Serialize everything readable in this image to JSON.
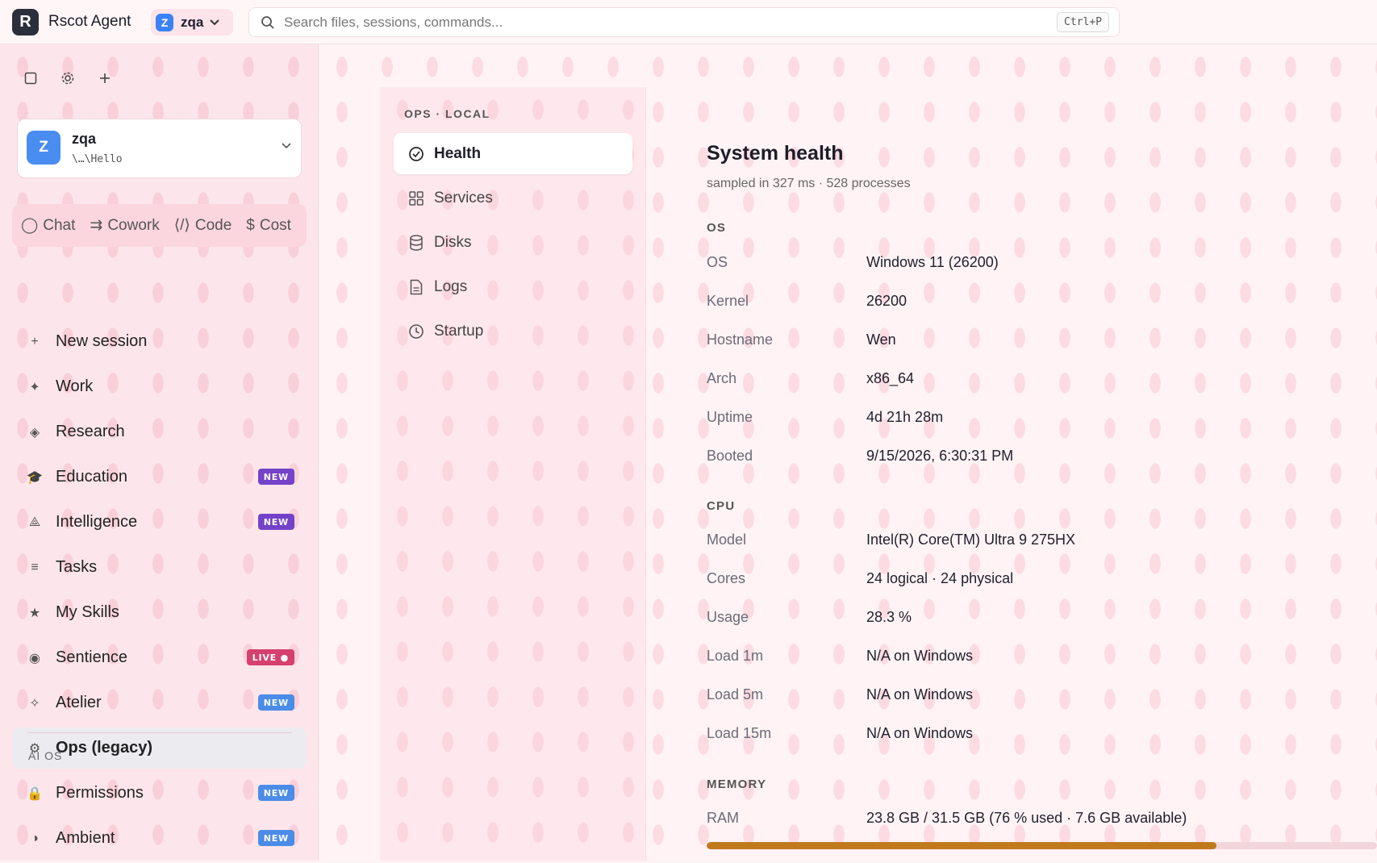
{
  "app": {
    "name": "Rscot Agent",
    "logo_letter": "R"
  },
  "workspace_pill": {
    "avatar": "Z",
    "name": "zqa"
  },
  "search": {
    "placeholder": "Search files, sessions, commands...",
    "shortcut": "Ctrl+P"
  },
  "workspace_card": {
    "avatar": "Z",
    "name": "zqa",
    "path": "\\…\\Hello"
  },
  "mode_tabs": [
    {
      "icon": "◯",
      "label": "Chat"
    },
    {
      "icon": "⇉",
      "label": "Cowork"
    },
    {
      "icon": "⟨/⟩",
      "label": "Code"
    },
    {
      "icon": "$",
      "label": "Cost"
    }
  ],
  "nav": [
    {
      "icon": "+",
      "label": "New session",
      "badge": ""
    },
    {
      "icon": "✦",
      "label": "Work",
      "badge": ""
    },
    {
      "icon": "◈",
      "label": "Research",
      "badge": ""
    },
    {
      "icon": "🎓",
      "label": "Education",
      "badge": "NEW"
    },
    {
      "icon": "⟁",
      "label": "Intelligence",
      "badge": "NEW"
    },
    {
      "icon": "≡",
      "label": "Tasks",
      "badge": ""
    },
    {
      "icon": "★",
      "label": "My Skills",
      "badge": ""
    },
    {
      "icon": "◉",
      "label": "Sentience",
      "badge": "LIVE ●"
    },
    {
      "icon": "✧",
      "label": "Atelier",
      "badge": "NEW"
    },
    {
      "icon": "⚙",
      "label": "Ops (legacy)",
      "badge": ""
    }
  ],
  "section_ai_os": "AI OS",
  "nav_ai_os": [
    {
      "icon": "🔒",
      "label": "Permissions",
      "badge": "NEW"
    },
    {
      "icon": "◑",
      "label": "Ambient",
      "badge": "NEW"
    }
  ],
  "ops": {
    "header": "OPS · LOCAL",
    "items": [
      "Health",
      "Services",
      "Disks",
      "Logs",
      "Startup"
    ]
  },
  "health": {
    "title": "System health",
    "subtitle": "sampled in 327 ms · 528 processes",
    "os_section": "OS",
    "os": [
      {
        "k": "OS",
        "v": "Windows 11 (26200)"
      },
      {
        "k": "Kernel",
        "v": "26200"
      },
      {
        "k": "Hostname",
        "v": "Wen"
      },
      {
        "k": "Arch",
        "v": "x86_64"
      },
      {
        "k": "Uptime",
        "v": "4d 21h 28m"
      },
      {
        "k": "Booted",
        "v": "9/15/2026, 6:30:31 PM"
      }
    ],
    "cpu_section": "CPU",
    "cpu": [
      {
        "k": "Model",
        "v": "Intel(R) Core(TM) Ultra 9 275HX"
      },
      {
        "k": "Cores",
        "v": "24 logical · 24 physical"
      },
      {
        "k": "Usage",
        "v": "28.3 %"
      },
      {
        "k": "Load 1m",
        "v": "N/A on Windows"
      },
      {
        "k": "Load 5m",
        "v": "N/A on Windows"
      },
      {
        "k": "Load 15m",
        "v": "N/A on Windows"
      }
    ],
    "memory_section": "MEMORY",
    "ram": {
      "k": "RAM",
      "v": "23.8 GB / 31.5 GB (76 % used · 7.6 GB available)",
      "used_fraction": 0.76
    }
  },
  "colors": {
    "accent": "#4a8df0",
    "ram_bar": "#c07a1c",
    "badge_new_purple": "#7442c8",
    "badge_new_blue": "#4a8ce8",
    "badge_live": "#d6406e"
  }
}
